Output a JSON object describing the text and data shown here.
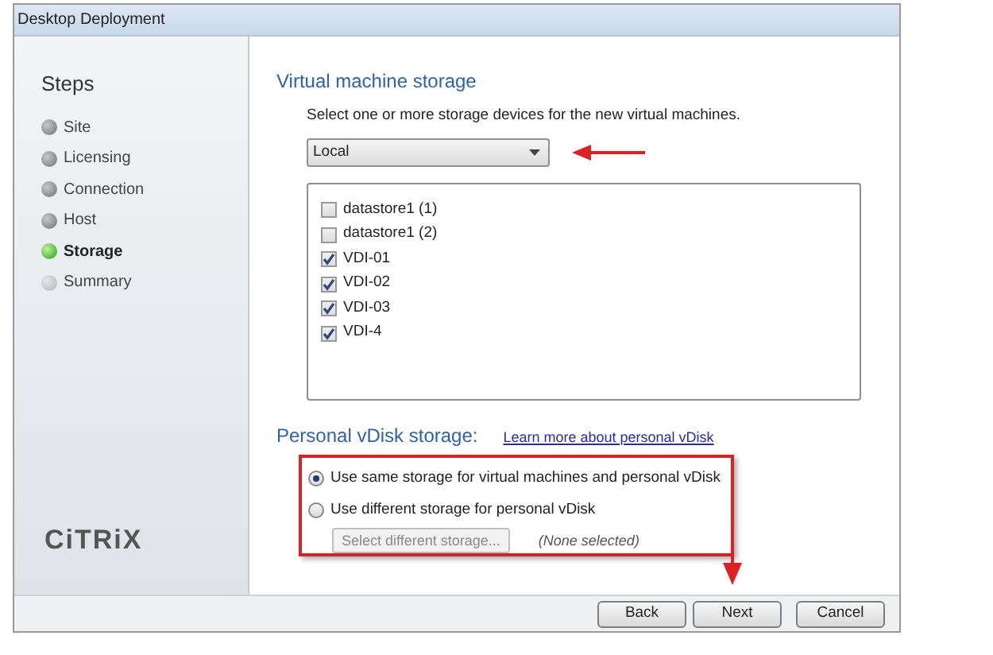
{
  "window": {
    "title": "Desktop Deployment"
  },
  "sidebar": {
    "heading": "Steps",
    "items": [
      {
        "label": "Site",
        "kind": "done",
        "selected": false
      },
      {
        "label": "Licensing",
        "kind": "done",
        "selected": false
      },
      {
        "label": "Connection",
        "kind": "done",
        "selected": false
      },
      {
        "label": "Host",
        "kind": "done",
        "selected": false
      },
      {
        "label": "Storage",
        "kind": "current",
        "selected": true
      },
      {
        "label": "Summary",
        "kind": "pending",
        "selected": false
      }
    ],
    "logo": "CiTRiX"
  },
  "vm_storage": {
    "heading": "Virtual machine storage",
    "instruction": "Select one or more storage devices for the new virtual machines.",
    "dropdown": {
      "value": "Local"
    },
    "devices": [
      {
        "label": "datastore1 (1)",
        "checked": false
      },
      {
        "label": "datastore1 (2)",
        "checked": false
      },
      {
        "label": "VDI-01",
        "checked": true
      },
      {
        "label": "VDI-02",
        "checked": true
      },
      {
        "label": "VDI-03",
        "checked": true
      },
      {
        "label": "VDI-4",
        "checked": true
      }
    ]
  },
  "vdisk_storage": {
    "heading": "Personal vDisk storage:",
    "link": "Learn more about personal vDisk",
    "options": [
      {
        "label": "Use same storage for virtual machines and personal vDisk",
        "selected": true
      },
      {
        "label": "Use different storage for personal vDisk",
        "selected": false
      }
    ],
    "select_button": {
      "label": "Select different storage...",
      "disabled": true
    },
    "selection_note": "(None selected)"
  },
  "buttons": [
    {
      "label": "Back"
    },
    {
      "label": "Next"
    },
    {
      "label": "Cancel"
    }
  ]
}
